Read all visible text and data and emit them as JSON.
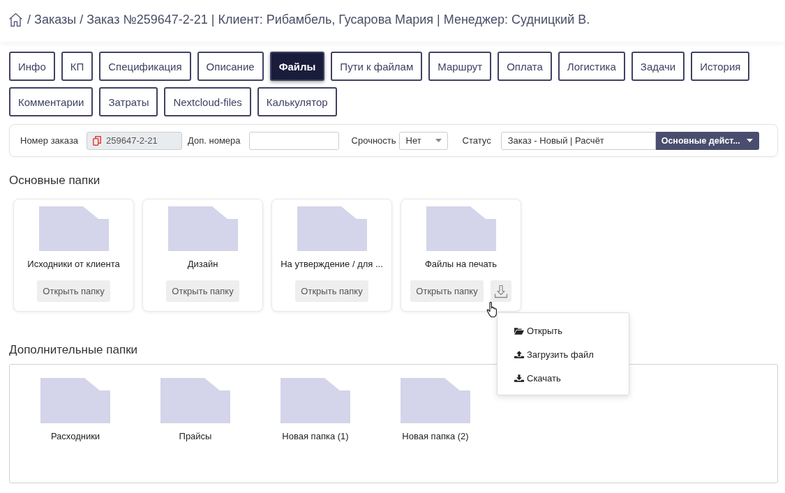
{
  "breadcrumb": [
    {
      "separator": "/",
      "text": "Заказы"
    },
    {
      "separator": "/",
      "text": "Заказ №259647-2-21 | Клиент: Рибамбель, Гусарова Мария | Менеджер: Судницкий В."
    }
  ],
  "tab_rows": [
    [
      {
        "label": "Инфо",
        "selected": false
      },
      {
        "label": "КП",
        "selected": false
      },
      {
        "label": "Спецификация",
        "selected": false
      },
      {
        "label": "Описание",
        "selected": false
      },
      {
        "label": "Файлы",
        "selected": true
      },
      {
        "label": "Пути к файлам",
        "selected": false
      },
      {
        "label": "Маршрут",
        "selected": false
      },
      {
        "label": "Оплата",
        "selected": false
      },
      {
        "label": "Логистика",
        "selected": false
      },
      {
        "label": "Задачи",
        "selected": false
      },
      {
        "label": "История",
        "selected": false
      }
    ],
    [
      {
        "label": "Комментарии",
        "selected": false
      },
      {
        "label": "Затраты",
        "selected": false
      },
      {
        "label": "Nextcloud-files",
        "selected": false
      },
      {
        "label": "Калькулятор",
        "selected": false
      }
    ]
  ],
  "order_bar": {
    "order_number": {
      "label": "Номер заказа",
      "value": "259647-2-21"
    },
    "extra_numbers": {
      "label": "Доп. номера"
    },
    "urgency": {
      "label": "Срочность",
      "value": "Нет"
    },
    "status": {
      "label": "Статус",
      "value": "Заказ - Новый | Расчёт",
      "action_button": "Основные дейст..."
    }
  },
  "main_folders": {
    "title": "Основные папки",
    "folders": [
      {
        "name": "Исходники от клиента",
        "button": "Открыть папку",
        "has_download": false
      },
      {
        "name": "Дизайн",
        "button": "Открыть папку",
        "has_download": false
      },
      {
        "name": "На утверждение / для ...",
        "button": "Открыть папку",
        "has_download": false
      },
      {
        "name": "Файлы на печать",
        "button": "Открыть папку",
        "has_download": true
      }
    ]
  },
  "context_menu": {
    "items": [
      {
        "kind": "open",
        "label": "Открыть"
      },
      {
        "kind": "upload",
        "label": "Загрузить файл"
      },
      {
        "kind": "download",
        "label": "Скачать"
      }
    ]
  },
  "extra_folders": {
    "title": "Дополнительные папки",
    "folders": [
      {
        "name": "Расходники"
      },
      {
        "name": "Прайсы"
      },
      {
        "name": "Новая папка (1)"
      },
      {
        "name": "Новая папка (2)"
      }
    ]
  }
}
